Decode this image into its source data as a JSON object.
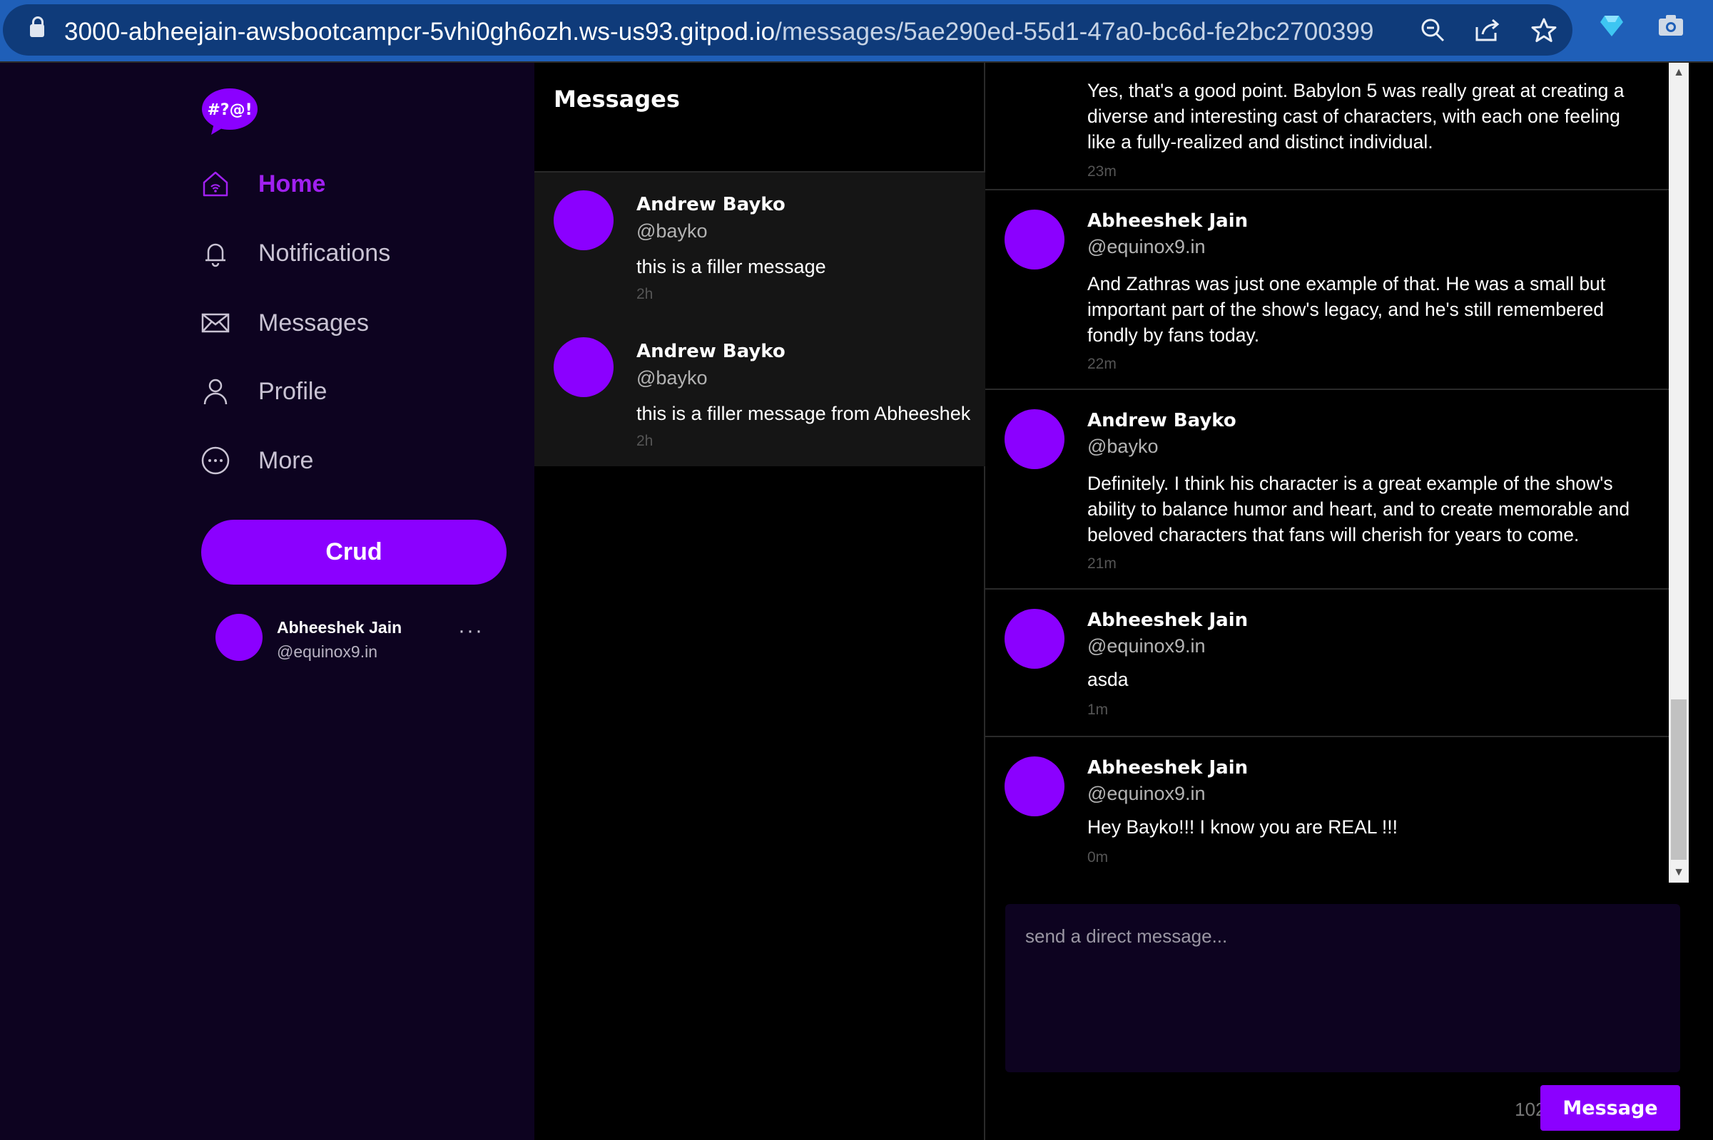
{
  "browser": {
    "url_host": "3000-abheejain-awsbootcampcr-5vhi0gh6ozh.ws-us93.gitpod.io",
    "url_path": "/messages/5ae290ed-55d1-47a0-bc6d-fe2bc2700399",
    "icons": [
      "lock-icon",
      "zoom-icon",
      "share-icon",
      "star-icon",
      "extension-icon",
      "camera-icon"
    ]
  },
  "brand": {
    "logo_text": "#?@!"
  },
  "nav": [
    {
      "label": "Home",
      "icon": "home-icon",
      "active": true
    },
    {
      "label": "Notifications",
      "icon": "bell-icon",
      "active": false
    },
    {
      "label": "Messages",
      "icon": "mail-icon",
      "active": false
    },
    {
      "label": "Profile",
      "icon": "user-icon",
      "active": false
    },
    {
      "label": "More",
      "icon": "more-circle-icon",
      "active": false
    }
  ],
  "crud_button": "Crud",
  "current_user": {
    "name": "Abheeshek Jain",
    "handle": "@equinox9.in",
    "menu": "···"
  },
  "conversations": {
    "title": "Messages",
    "items": [
      {
        "name": "Andrew Bayko",
        "handle": "@bayko",
        "message": "this is a filler message",
        "time": "2h"
      },
      {
        "name": "Andrew Bayko",
        "handle": "@bayko",
        "message": "this is a filler message from Abheeshek",
        "time": "2h"
      }
    ]
  },
  "thread": {
    "messages": [
      {
        "name": "",
        "handle": "",
        "text": "Yes, that's a good point. Babylon 5 was really great at creating a diverse and interesting cast of characters, with each one feeling like a fully-realized and distinct individual.",
        "time": "23m"
      },
      {
        "name": "Abheeshek Jain",
        "handle": "@equinox9.in",
        "text": "And Zathras was just one example of that. He was a small but important part of the show's legacy, and he's still remembered fondly by fans today.",
        "time": "22m"
      },
      {
        "name": "Andrew Bayko",
        "handle": "@bayko",
        "text": "Definitely. I think his character is a great example of the show's ability to balance humor and heart, and to create memorable and beloved characters that fans will cherish for years to come.",
        "time": "21m"
      },
      {
        "name": "Abheeshek Jain",
        "handle": "@equinox9.in",
        "text": "asda",
        "time": "1m"
      },
      {
        "name": "Abheeshek Jain",
        "handle": "@equinox9.in",
        "text": "Hey Bayko!!! I know you are REAL !!!",
        "time": "0m"
      }
    ]
  },
  "composer": {
    "placeholder": "send a direct message...",
    "counter": "1024",
    "send_label": "Message"
  },
  "colors": {
    "accent": "#8b00ff",
    "sidebar_bg": "#0d0320",
    "active_nav": "#a020f0"
  }
}
